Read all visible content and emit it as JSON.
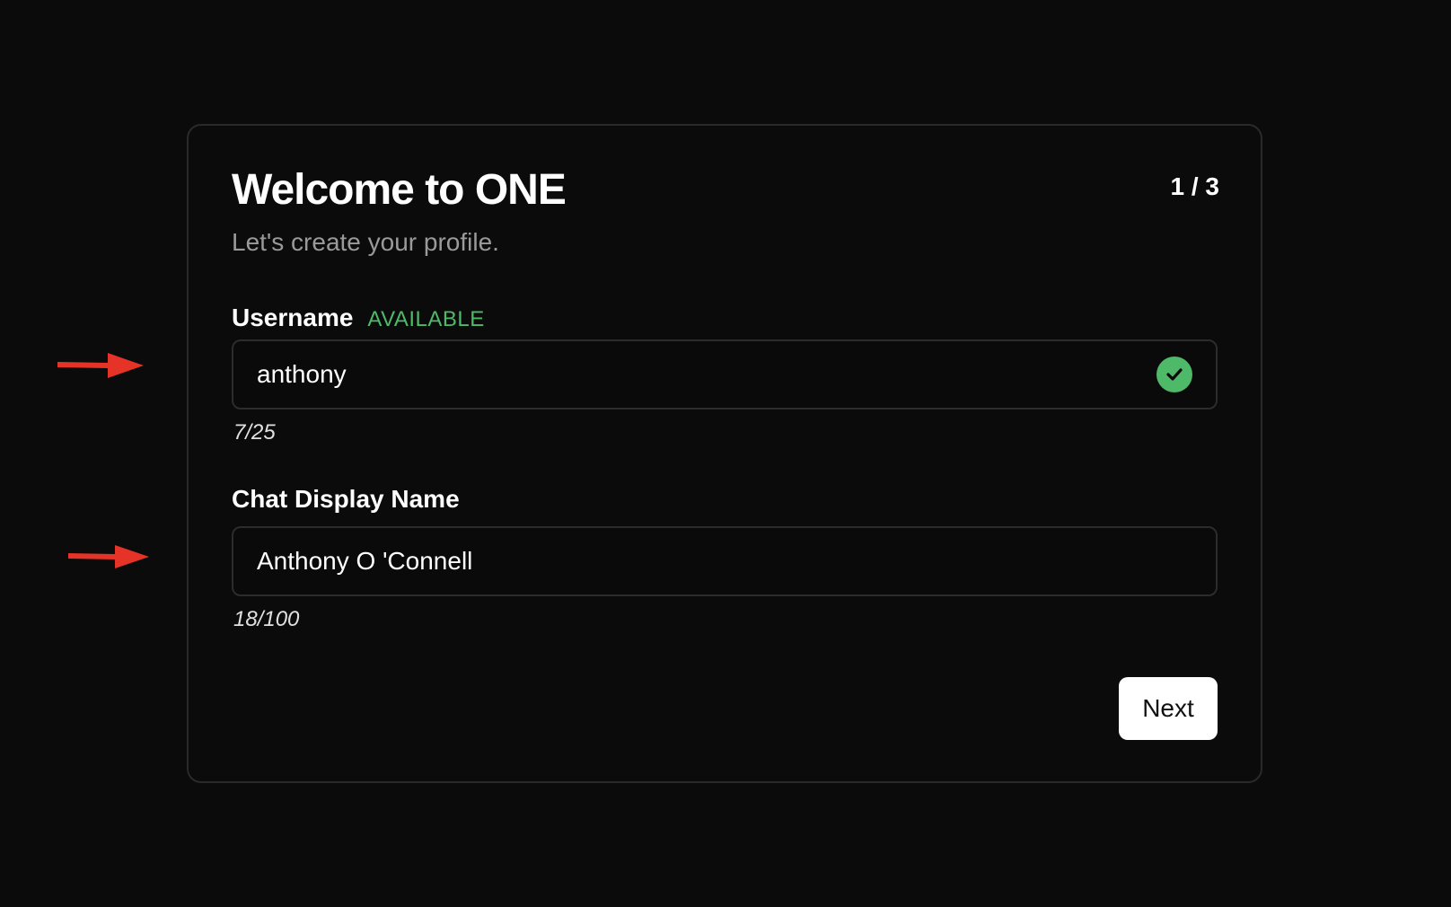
{
  "onboarding": {
    "title": "Welcome to ONE",
    "subtitle": "Let's create your profile.",
    "step_indicator": "1 / 3"
  },
  "username": {
    "label": "Username",
    "status": "AVAILABLE",
    "value": "anthony",
    "counter": "7/25",
    "status_icon": "check-circle-icon"
  },
  "display_name": {
    "label": "Chat Display Name",
    "value": "Anthony O 'Connell",
    "counter": "18/100"
  },
  "actions": {
    "next_label": "Next"
  },
  "annotations": {
    "arrow_icon": "red-arrow-icon",
    "arrow_color": "#e53327"
  },
  "colors": {
    "background": "#0b0b0b",
    "accent_green": "#4fb96a",
    "button_bg": "#ffffff"
  }
}
